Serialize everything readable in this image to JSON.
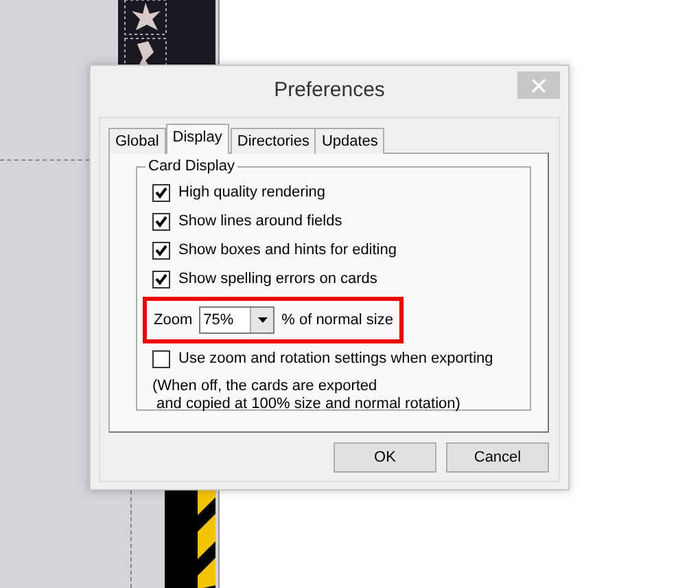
{
  "dialog": {
    "title": "Preferences",
    "tabs": [
      {
        "label": "Global",
        "selected": false
      },
      {
        "label": "Display",
        "selected": true
      },
      {
        "label": "Directories",
        "selected": false
      },
      {
        "label": "Updates",
        "selected": false
      }
    ],
    "group": {
      "title": "Card Display",
      "options": [
        {
          "label": "High quality rendering",
          "checked": true
        },
        {
          "label": "Show lines around fields",
          "checked": true
        },
        {
          "label": "Show boxes and hints for editing",
          "checked": true
        },
        {
          "label": "Show spelling errors on cards",
          "checked": true
        }
      ],
      "zoom": {
        "label": "Zoom",
        "value": "75%",
        "suffix": "% of normal size",
        "highlighted": true
      },
      "export_option": {
        "label": "Use zoom and rotation settings when exporting",
        "checked": false
      },
      "note": [
        "(When off, the cards are exported",
        " and copied at 100% size and normal rotation)"
      ]
    },
    "buttons": [
      {
        "label": "OK"
      },
      {
        "label": "Cancel"
      }
    ]
  }
}
